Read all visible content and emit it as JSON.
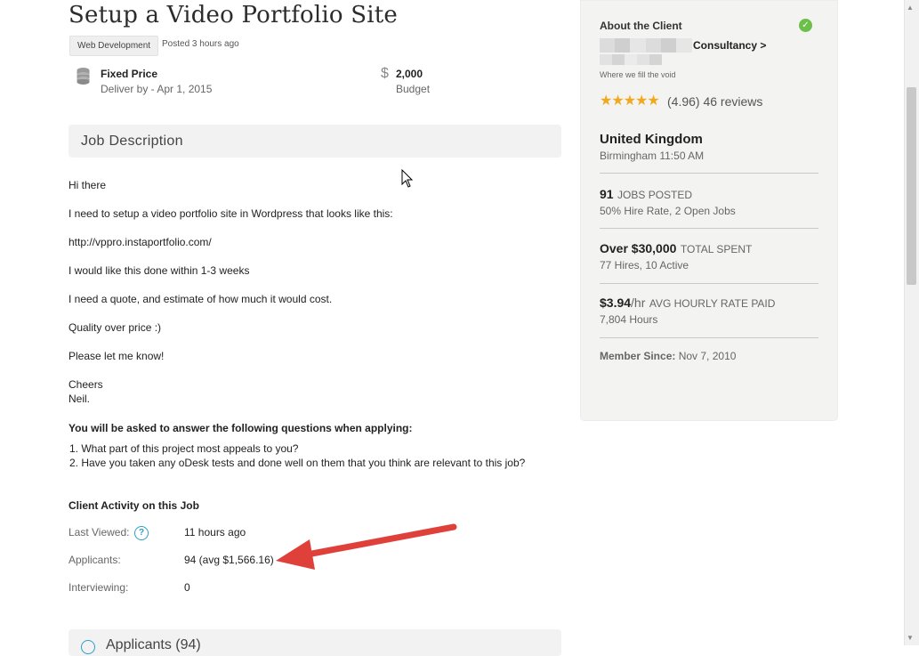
{
  "job": {
    "title": "Setup a Video Portfolio Site",
    "category": "Web Development",
    "posted": "Posted 3 hours ago",
    "price_type": "Fixed Price",
    "deliver_by": "Deliver by - Apr 1, 2015",
    "budget_symbol": "$",
    "budget_value": "2,000",
    "budget_label": "Budget"
  },
  "description": {
    "header": "Job Description",
    "lines": [
      "Hi there",
      "I need to setup a video portfolio site in Wordpress that looks like this:",
      "http://vppro.instaportfolio.com/",
      "I would like this done within 1-3 weeks",
      "I need a quote, and estimate of how much it would cost.",
      "Quality over price :)",
      "Please let me know!",
      "Cheers",
      "Neil."
    ]
  },
  "questions": {
    "header": "You will be asked to answer the following questions when applying:",
    "items": [
      "1.  What part of this project most appeals to you?",
      "2.  Have you taken any oDesk tests and done well on them that you think are relevant to this job?"
    ]
  },
  "activity": {
    "header": "Client Activity on this Job",
    "last_viewed_label": "Last Viewed:",
    "last_viewed_value": "11 hours ago",
    "applicants_label": "Applicants:",
    "applicants_value": "94 (avg $1,566.16)",
    "interviewing_label": "Interviewing:",
    "interviewing_value": "0",
    "help_glyph": "?"
  },
  "applicants_section": {
    "header": "Applicants (94)"
  },
  "client": {
    "about_label": "About the Client",
    "company_suffix": "Consultancy >",
    "tagline": "Where we fill the void",
    "stars": "★★★★★",
    "rating": "(4.96) 46 reviews",
    "country": "United Kingdom",
    "city_time": "Birmingham 11:50 AM",
    "jobs_posted_num": "91",
    "jobs_posted_label": "JOBS POSTED",
    "jobs_posted_sub": "50% Hire Rate, 2 Open Jobs",
    "spent_num": "Over $30,000",
    "spent_label": "TOTAL SPENT",
    "spent_sub": "77 Hires, 10 Active",
    "rate_num": "$3.94",
    "rate_unit": "/hr",
    "rate_label": "AVG HOURLY RATE PAID",
    "rate_sub": "7,804 Hours",
    "member_label": "Member Since:",
    "member_value": "Nov 7, 2010"
  },
  "colors": {
    "accent": "#2aa0c9",
    "verified": "#6cc04a",
    "stars": "#f2a81d",
    "arrow": "#e0403a"
  }
}
